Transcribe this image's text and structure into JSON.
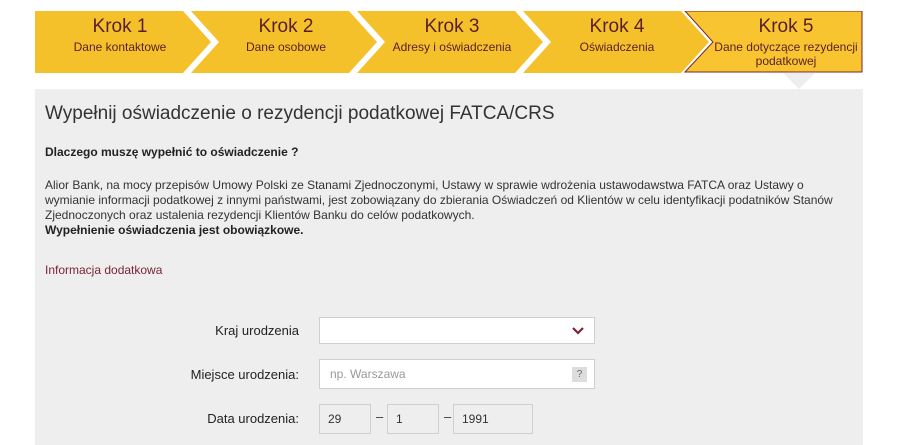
{
  "steps": [
    {
      "title": "Krok 1",
      "subtitle": "Dane kontaktowe"
    },
    {
      "title": "Krok 2",
      "subtitle": "Dane osobowe"
    },
    {
      "title": "Krok 3",
      "subtitle": "Adresy i oświadczenia"
    },
    {
      "title": "Krok 4",
      "subtitle": "Oświadczenia"
    },
    {
      "title": "Krok 5",
      "subtitle": "Dane dotyczące rezydencji podatkowej",
      "active": true
    }
  ],
  "page_title": "Wypełnij oświadczenie o rezydencji podatkowej FATCA/CRS",
  "question": "Dlaczego muszę wypełnić to oświadczenie ?",
  "description": "Alior Bank, na mocy przepisów Umowy Polski ze Stanami Zjednoczonymi, Ustawy w sprawie wdrożenia ustawodawstwa FATCA oraz Ustawy o wymianie informacji podatkowej z innymi państwami, jest zobowiązany do zbierania Oświadczeń od Klientów w celu identyfikacji podatników Stanów Zjednoczonych oraz ustalenia rezydencji Klientów Banku do celów podatkowych.",
  "mandatory_note": "Wypełnienie oświadczenia jest obowiązkowe.",
  "more_info_link": "Informacja dodatkowa",
  "form": {
    "country_label": "Kraj urodzenia",
    "country_value": "",
    "place_label": "Miejsce urodzenia:",
    "place_placeholder": "np. Warszawa",
    "help_label": "?",
    "date_label": "Data urodzenia:",
    "date_day": "29",
    "date_month": "1",
    "date_year": "1991",
    "date_separator": "–"
  },
  "colors": {
    "step_fill": "#f4c12a",
    "step_active_fill": "#f8c530",
    "step_active_border": "#7a2436",
    "step_text": "#5a1e2a",
    "panel_bg": "#eeeeee",
    "link": "#7a2436"
  },
  "icons": {
    "select_arrow": "chevron-down-icon"
  }
}
